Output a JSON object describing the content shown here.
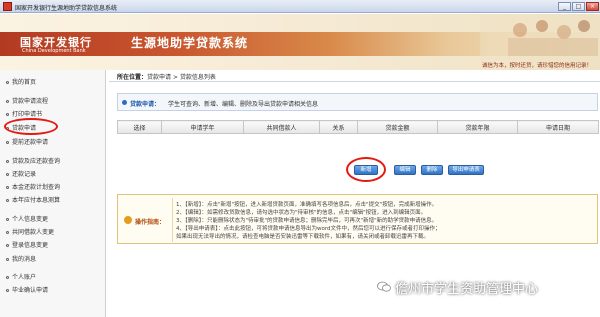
{
  "window": {
    "title": "国家开发银行生源地助学贷款信息系统",
    "controls": [
      "_",
      "□",
      "×"
    ]
  },
  "banner": {
    "logo_cn": "国家开发银行",
    "logo_en": "China Development Bank",
    "system_title": "生源地助学贷款系统",
    "slogan": "诚信为本，按时还贷，请珍惜您的信用记录！"
  },
  "sidebar": {
    "items": [
      {
        "label": "我的首页"
      },
      {
        "label": "贷款申请流程"
      },
      {
        "label": "打印申请书"
      },
      {
        "label": "贷款申请"
      },
      {
        "label": "提前还款申请"
      },
      {
        "label": "贷款及应还款查询"
      },
      {
        "label": "还款记录"
      },
      {
        "label": "本金还款计划查询"
      },
      {
        "label": "本年应付本息测算"
      },
      {
        "label": "个人信息变更"
      },
      {
        "label": "共同借款人变更"
      },
      {
        "label": "登录信息变更"
      },
      {
        "label": "我的消息"
      },
      {
        "label": "个人账户"
      },
      {
        "label": "毕业确认申请"
      }
    ]
  },
  "breadcrumb": {
    "prefix": "所在位置：",
    "path": "贷款申请 > 贷款信息列表"
  },
  "info": {
    "label": "贷款申请：",
    "text": "学生可查询、新增、编辑、删除及导出贷款申请相关信息"
  },
  "table": {
    "columns": [
      "选择",
      "申请学年",
      "共同借款人",
      "关系",
      "贷款金额",
      "贷款年限",
      "申请日期"
    ]
  },
  "buttons": {
    "add": "新增",
    "edit": "编辑",
    "delete": "删除",
    "export": "导出申请表"
  },
  "guide": {
    "label": "操作指南：",
    "lines": [
      "1、【新增】：点击\"新增\"按钮，进入新增贷款页面，准确填写各项信息后，点击\"提交\"按钮，完成新增操作。",
      "2、【编辑】：如需修改贷款信息，请勾选中状态为\"待审核\"的信息，点击\"编辑\"按钮，进入到编辑页面。",
      "3、【删除】：只能删除状态为\"待审批\"的贷款申请信息；删除完毕后，可再次\"新增\"新的助学贷款申请信息。",
      "4、【导出申请表】：点击此按钮，可将贷款申请信息导出为word文件中，然后您可以进行保存或者打印操作；",
      "如果出现无法导出的情况，请检查电脑是否安装迅雷等下载软件，如果有，请关闭或者卸载迅雷再下载。"
    ]
  },
  "watermark": {
    "text": "儋州市学生资助管理中心"
  },
  "colors": {
    "annotation": "#e21b12",
    "button": "#2f72c8",
    "brand": "#b33a22"
  }
}
